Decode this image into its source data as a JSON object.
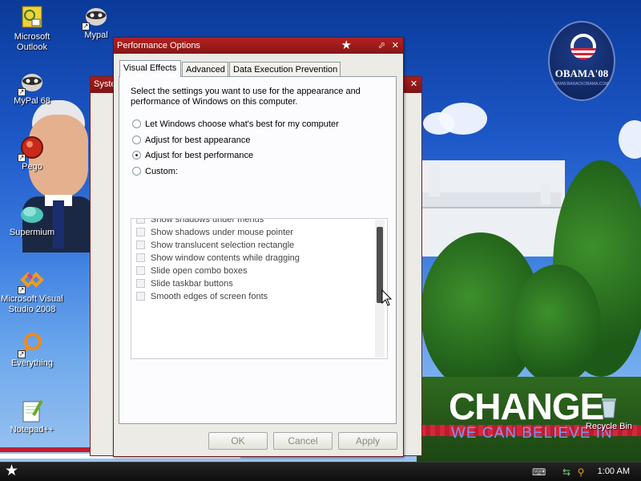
{
  "desktop": {
    "icons": [
      {
        "label": "Microsoft Outlook"
      },
      {
        "label": "Mypal"
      },
      {
        "label": "MyPal 68"
      },
      {
        "label": "Pego"
      },
      {
        "label": "Supermium"
      },
      {
        "label": "Microsoft Visual Studio 2008"
      },
      {
        "label": "Everything"
      },
      {
        "label": "Notepad++"
      },
      {
        "label": "Recycle Bin"
      }
    ],
    "logo_text": "OBAMA'08",
    "logo_subtext": "WWW.BARACKOBAMA.COM",
    "change_text": "CHANGE",
    "change_sub": "WE CAN BELIEVE IN"
  },
  "background_window": {
    "title": "Syste"
  },
  "dialog": {
    "title": "Performance Options",
    "tabs": [
      {
        "label": "Visual Effects",
        "active": true
      },
      {
        "label": "Advanced",
        "active": false
      },
      {
        "label": "Data Execution Prevention",
        "active": false
      }
    ],
    "intro": "Select the settings you want to use for the appearance and performance of Windows on this computer.",
    "radios": [
      {
        "label": "Let Windows choose what's best for my computer",
        "selected": false
      },
      {
        "label": "Adjust for best appearance",
        "selected": false
      },
      {
        "label": "Adjust for best performance",
        "selected": true
      },
      {
        "label": "Custom:",
        "selected": false
      }
    ],
    "options": [
      {
        "label": "Show shadows under menus",
        "checked": false
      },
      {
        "label": "Show shadows under mouse pointer",
        "checked": false
      },
      {
        "label": "Show translucent selection rectangle",
        "checked": false
      },
      {
        "label": "Show window contents while dragging",
        "checked": false
      },
      {
        "label": "Slide open combo boxes",
        "checked": false
      },
      {
        "label": "Slide taskbar buttons",
        "checked": false
      },
      {
        "label": "Smooth edges of screen fonts",
        "checked": false
      }
    ],
    "buttons": {
      "ok": "OK",
      "cancel": "Cancel",
      "apply": "Apply"
    }
  },
  "taskbar": {
    "clock": "1:00 AM",
    "tray_icons": [
      "keyboard-icon",
      "network-icon",
      "search-icon"
    ]
  },
  "colors": {
    "title_bar": "#b52121",
    "dialog_bg": "#ecebe6",
    "taskbar": "#1a1a1a"
  }
}
